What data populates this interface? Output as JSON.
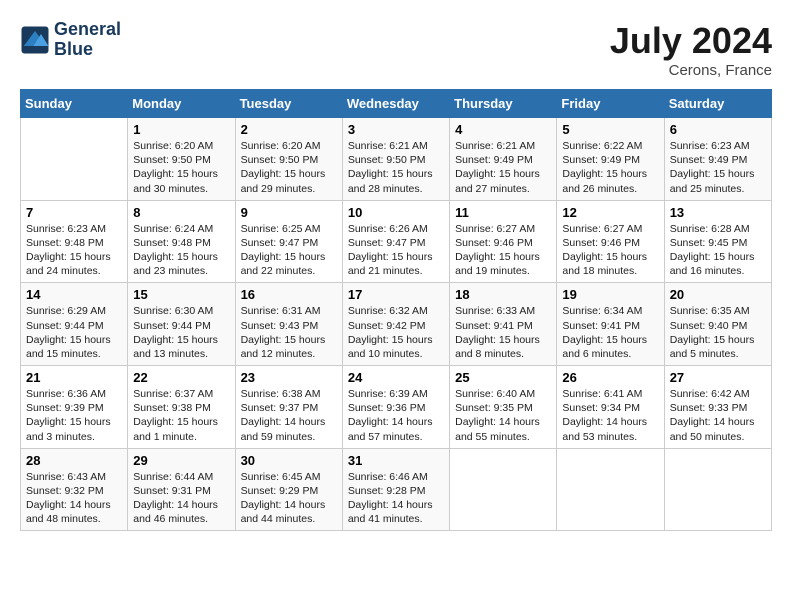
{
  "header": {
    "logo_line1": "General",
    "logo_line2": "Blue",
    "month_year": "July 2024",
    "location": "Cerons, France"
  },
  "columns": [
    "Sunday",
    "Monday",
    "Tuesday",
    "Wednesday",
    "Thursday",
    "Friday",
    "Saturday"
  ],
  "weeks": [
    [
      {
        "day": "",
        "info": ""
      },
      {
        "day": "1",
        "info": "Sunrise: 6:20 AM\nSunset: 9:50 PM\nDaylight: 15 hours\nand 30 minutes."
      },
      {
        "day": "2",
        "info": "Sunrise: 6:20 AM\nSunset: 9:50 PM\nDaylight: 15 hours\nand 29 minutes."
      },
      {
        "day": "3",
        "info": "Sunrise: 6:21 AM\nSunset: 9:50 PM\nDaylight: 15 hours\nand 28 minutes."
      },
      {
        "day": "4",
        "info": "Sunrise: 6:21 AM\nSunset: 9:49 PM\nDaylight: 15 hours\nand 27 minutes."
      },
      {
        "day": "5",
        "info": "Sunrise: 6:22 AM\nSunset: 9:49 PM\nDaylight: 15 hours\nand 26 minutes."
      },
      {
        "day": "6",
        "info": "Sunrise: 6:23 AM\nSunset: 9:49 PM\nDaylight: 15 hours\nand 25 minutes."
      }
    ],
    [
      {
        "day": "7",
        "info": "Sunrise: 6:23 AM\nSunset: 9:48 PM\nDaylight: 15 hours\nand 24 minutes."
      },
      {
        "day": "8",
        "info": "Sunrise: 6:24 AM\nSunset: 9:48 PM\nDaylight: 15 hours\nand 23 minutes."
      },
      {
        "day": "9",
        "info": "Sunrise: 6:25 AM\nSunset: 9:47 PM\nDaylight: 15 hours\nand 22 minutes."
      },
      {
        "day": "10",
        "info": "Sunrise: 6:26 AM\nSunset: 9:47 PM\nDaylight: 15 hours\nand 21 minutes."
      },
      {
        "day": "11",
        "info": "Sunrise: 6:27 AM\nSunset: 9:46 PM\nDaylight: 15 hours\nand 19 minutes."
      },
      {
        "day": "12",
        "info": "Sunrise: 6:27 AM\nSunset: 9:46 PM\nDaylight: 15 hours\nand 18 minutes."
      },
      {
        "day": "13",
        "info": "Sunrise: 6:28 AM\nSunset: 9:45 PM\nDaylight: 15 hours\nand 16 minutes."
      }
    ],
    [
      {
        "day": "14",
        "info": "Sunrise: 6:29 AM\nSunset: 9:44 PM\nDaylight: 15 hours\nand 15 minutes."
      },
      {
        "day": "15",
        "info": "Sunrise: 6:30 AM\nSunset: 9:44 PM\nDaylight: 15 hours\nand 13 minutes."
      },
      {
        "day": "16",
        "info": "Sunrise: 6:31 AM\nSunset: 9:43 PM\nDaylight: 15 hours\nand 12 minutes."
      },
      {
        "day": "17",
        "info": "Sunrise: 6:32 AM\nSunset: 9:42 PM\nDaylight: 15 hours\nand 10 minutes."
      },
      {
        "day": "18",
        "info": "Sunrise: 6:33 AM\nSunset: 9:41 PM\nDaylight: 15 hours\nand 8 minutes."
      },
      {
        "day": "19",
        "info": "Sunrise: 6:34 AM\nSunset: 9:41 PM\nDaylight: 15 hours\nand 6 minutes."
      },
      {
        "day": "20",
        "info": "Sunrise: 6:35 AM\nSunset: 9:40 PM\nDaylight: 15 hours\nand 5 minutes."
      }
    ],
    [
      {
        "day": "21",
        "info": "Sunrise: 6:36 AM\nSunset: 9:39 PM\nDaylight: 15 hours\nand 3 minutes."
      },
      {
        "day": "22",
        "info": "Sunrise: 6:37 AM\nSunset: 9:38 PM\nDaylight: 15 hours\nand 1 minute."
      },
      {
        "day": "23",
        "info": "Sunrise: 6:38 AM\nSunset: 9:37 PM\nDaylight: 14 hours\nand 59 minutes."
      },
      {
        "day": "24",
        "info": "Sunrise: 6:39 AM\nSunset: 9:36 PM\nDaylight: 14 hours\nand 57 minutes."
      },
      {
        "day": "25",
        "info": "Sunrise: 6:40 AM\nSunset: 9:35 PM\nDaylight: 14 hours\nand 55 minutes."
      },
      {
        "day": "26",
        "info": "Sunrise: 6:41 AM\nSunset: 9:34 PM\nDaylight: 14 hours\nand 53 minutes."
      },
      {
        "day": "27",
        "info": "Sunrise: 6:42 AM\nSunset: 9:33 PM\nDaylight: 14 hours\nand 50 minutes."
      }
    ],
    [
      {
        "day": "28",
        "info": "Sunrise: 6:43 AM\nSunset: 9:32 PM\nDaylight: 14 hours\nand 48 minutes."
      },
      {
        "day": "29",
        "info": "Sunrise: 6:44 AM\nSunset: 9:31 PM\nDaylight: 14 hours\nand 46 minutes."
      },
      {
        "day": "30",
        "info": "Sunrise: 6:45 AM\nSunset: 9:29 PM\nDaylight: 14 hours\nand 44 minutes."
      },
      {
        "day": "31",
        "info": "Sunrise: 6:46 AM\nSunset: 9:28 PM\nDaylight: 14 hours\nand 41 minutes."
      },
      {
        "day": "",
        "info": ""
      },
      {
        "day": "",
        "info": ""
      },
      {
        "day": "",
        "info": ""
      }
    ]
  ]
}
